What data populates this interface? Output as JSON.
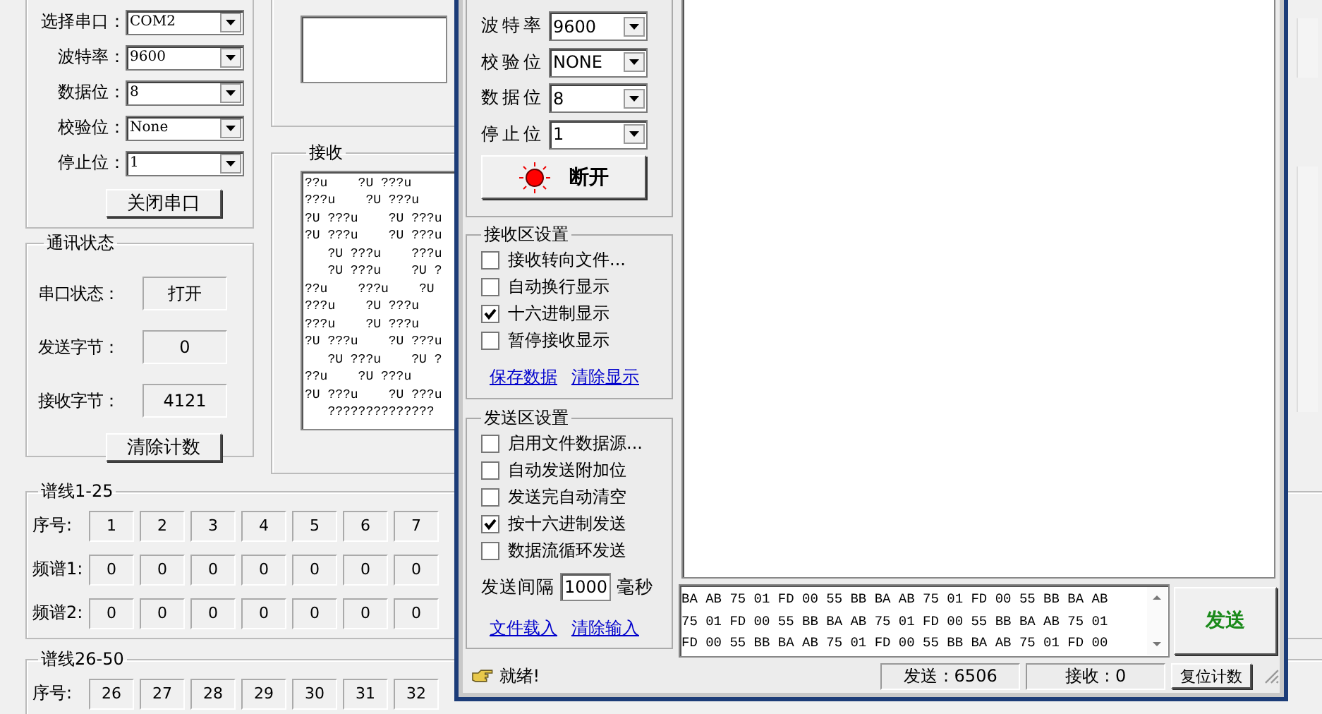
{
  "main_window": {
    "serial_settings": [
      {
        "label": "选择串口：",
        "value": "COM2"
      },
      {
        "label": "波特率：",
        "value": "9600"
      },
      {
        "label": "数据位：",
        "value": "8"
      },
      {
        "label": "校验位：",
        "value": "None"
      },
      {
        "label": "停止位：",
        "value": "1"
      }
    ],
    "close_port_button": "关闭串口",
    "status_group": {
      "title": "通讯状态",
      "fields": [
        {
          "label": "串口状态：",
          "value": "打开"
        },
        {
          "label": "发送字节：",
          "value": "0"
        },
        {
          "label": "接收字节：",
          "value": "4121"
        }
      ],
      "clear_button": "清除计数"
    },
    "receive_group": {
      "title": "接收",
      "lines": [
        "??u    ?U ???u",
        "???u    ?U ???u",
        "?U ???u    ?U ???u",
        "?U ???u    ?U ???u",
        "   ?U ???u    ???u",
        "   ?U ???u    ?U ?",
        "??u    ???u    ?U",
        "???u    ?U ???u",
        "???u    ?U ???u",
        "?U ???u    ?U ???u",
        "   ?U ???u    ?U ?",
        "??u    ?U ???u",
        "?U ???u    ?U ???u",
        "   ??????????????"
      ]
    },
    "spectrum_groups": [
      {
        "title": "谱线1-25",
        "rows": [
          {
            "label": "序号:",
            "cells": [
              "1",
              "2",
              "3",
              "4",
              "5",
              "6",
              "7"
            ]
          },
          {
            "label": "频谱1:",
            "cells": [
              "0",
              "0",
              "0",
              "0",
              "0",
              "0",
              "0"
            ]
          },
          {
            "label": "频谱2:",
            "cells": [
              "0",
              "0",
              "0",
              "0",
              "0",
              "0",
              "0"
            ]
          }
        ]
      },
      {
        "title": "谱线26-50",
        "rows": [
          {
            "label": "序号:",
            "cells": [
              "26",
              "27",
              "28",
              "29",
              "30",
              "31",
              "32"
            ]
          }
        ]
      }
    ]
  },
  "serial_window": {
    "settings": [
      {
        "label": "波特率",
        "value": "9600"
      },
      {
        "label": "校验位",
        "value": "NONE"
      },
      {
        "label": "数据位",
        "value": "8"
      },
      {
        "label": "停止位",
        "value": "1"
      }
    ],
    "connect_button": {
      "label": "断开",
      "on": true
    },
    "receive_settings": {
      "title": "接收区设置",
      "options": [
        {
          "label": "接收转向文件...",
          "checked": false
        },
        {
          "label": "自动换行显示",
          "checked": false
        },
        {
          "label": "十六进制显示",
          "checked": true
        },
        {
          "label": "暂停接收显示",
          "checked": false
        }
      ],
      "links": [
        "保存数据",
        "清除显示"
      ]
    },
    "send_settings": {
      "title": "发送区设置",
      "options": [
        {
          "label": "启用文件数据源...",
          "checked": false
        },
        {
          "label": "自动发送附加位",
          "checked": false
        },
        {
          "label": "发送完自动清空",
          "checked": false
        },
        {
          "label": "按十六进制发送",
          "checked": true
        },
        {
          "label": "数据流循环发送",
          "checked": false
        }
      ],
      "interval_label": "发送间隔",
      "interval_value": "1000",
      "interval_unit": "毫秒",
      "links": [
        "文件载入",
        "清除输入"
      ]
    },
    "send_lines": [
      "BA AB 75 01 FD 00 55 BB BA AB 75 01 FD 00 55 BB BA AB",
      "75 01 FD 00 55 BB BA AB 75 01 FD 00 55 BB BA AB 75 01",
      "FD 00 55 BB BA AB 75 01 FD 00 55 BB BA AB 75 01 FD 00"
    ],
    "send_button": "发送",
    "status": {
      "message": "就绪!",
      "sent": "发送 : 6506",
      "received": "接收 : 0",
      "reset_button": "复位计数"
    }
  }
}
